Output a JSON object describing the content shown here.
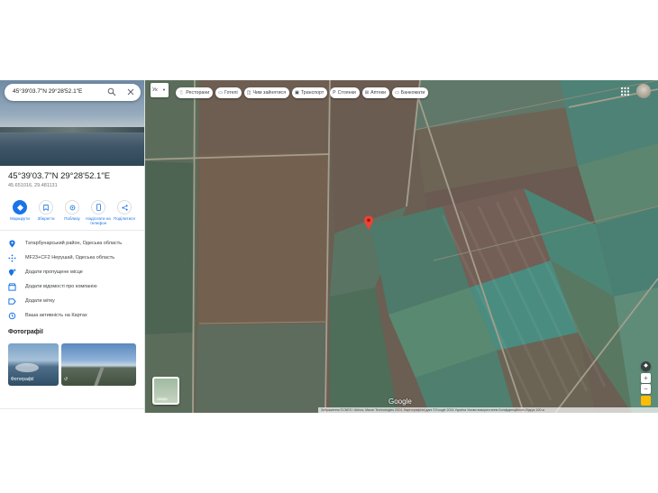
{
  "search": {
    "value": "45°39'03.7\"N 29°28'52.1\"E"
  },
  "place": {
    "title": "45°39'03.7\"N 29°28'52.1\"E",
    "decimal": "45.651016, 29.481131"
  },
  "actions": [
    {
      "label": "Маршрути",
      "icon": "directions-icon"
    },
    {
      "label": "Зберегти",
      "icon": "bookmark-icon"
    },
    {
      "label": "Поблизу",
      "icon": "nearby-icon"
    },
    {
      "label": "Надіслати на телефон",
      "icon": "send-to-phone-icon"
    },
    {
      "label": "Поділитися",
      "icon": "share-icon"
    }
  ],
  "info": [
    {
      "text": "Татарбунарський район, Одеська область",
      "icon": "location-pin-icon"
    },
    {
      "text": "MF23+CF2 Нерушай, Одеська область",
      "icon": "plus-code-icon"
    },
    {
      "text": "Додати пропущене місце",
      "icon": "add-place-icon"
    },
    {
      "text": "Додати відомості про компанію",
      "icon": "business-icon"
    },
    {
      "text": "Додати мітку",
      "icon": "label-icon"
    },
    {
      "text": "Ваша активність на Картах",
      "icon": "history-icon"
    }
  ],
  "photos": {
    "heading": "Фотографії",
    "thumb1_caption": "Фотографії",
    "thumb2_caption": "↺"
  },
  "map": {
    "language": "Ук",
    "chips": [
      {
        "label": "Ресторани",
        "icon": "🍴"
      },
      {
        "label": "Готелі",
        "icon": "▭"
      },
      {
        "label": "Чим зайнятися",
        "icon": "◫"
      },
      {
        "label": "Транспорт",
        "icon": "▣"
      },
      {
        "label": "Стоянки",
        "icon": "P"
      },
      {
        "label": "Аптеки",
        "icon": "⊞"
      },
      {
        "label": "Банкомати",
        "icon": "▭"
      }
    ],
    "layers_label": "Шари",
    "logo": "Google",
    "attribution": "Зображення ©CNES / Airbus, Maxar Technologies 2024, Картографічні дані ©Google 2024   Україна   Умови використання   Конфіденційність   Відгук   100 м"
  },
  "colors": {
    "accent": "#1a73e8",
    "pin": "#ea4335"
  }
}
